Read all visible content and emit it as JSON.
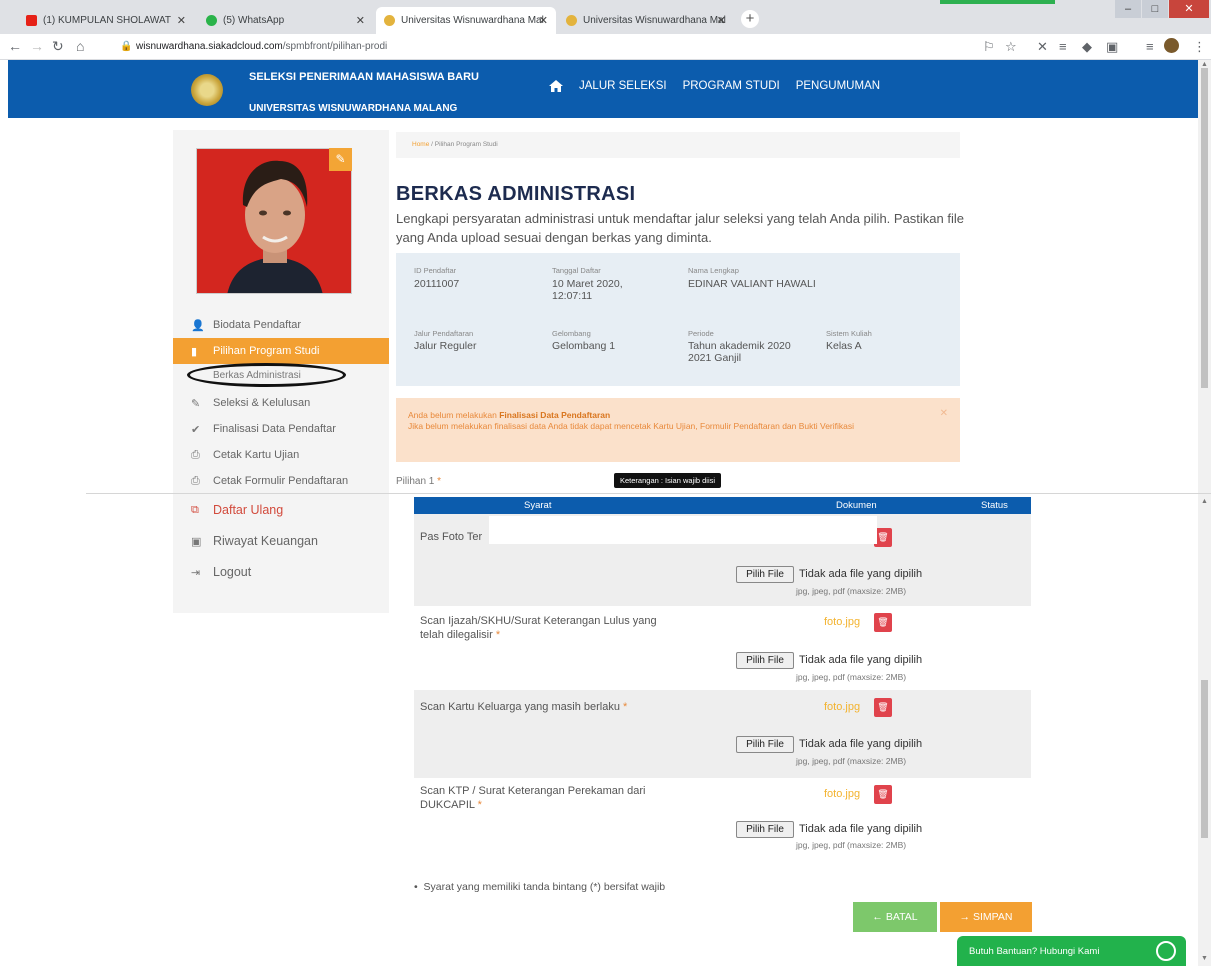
{
  "browser": {
    "tabs": [
      {
        "title": "(1) KUMPULAN SHOLAWAT",
        "color": "#e62117"
      },
      {
        "title": "(5) WhatsApp",
        "color": "#2ab34a"
      },
      {
        "title": "Universitas Wisnuwardhana Mal",
        "color": "#e3b33d"
      },
      {
        "title": "Universitas Wisnuwardhana Mal",
        "color": "#e3b33d"
      }
    ],
    "url_host": "wisnuwardhana.siakadcloud.com",
    "url_path": "/spmbfront/pilihan-prodi"
  },
  "header": {
    "brand_title": "SELEKSI PENERIMAAN MAHASISWA BARU",
    "brand_subtitle": "UNIVERSITAS WISNUWARDHANA MALANG",
    "nav": [
      "JALUR SELEKSI",
      "PROGRAM STUDI",
      "PENGUMUMAN"
    ]
  },
  "sidebar": {
    "menu": [
      {
        "label": "Biodata Pendaftar",
        "icon": "user-icon"
      },
      {
        "label": "Pilihan Program Studi",
        "icon": "bookmark-icon"
      },
      {
        "label": "Berkas Administrasi",
        "icon": "dash-icon"
      },
      {
        "label": "Seleksi & Kelulusan",
        "icon": "edit-icon"
      },
      {
        "label": "Finalisasi Data Pendaftar",
        "icon": "check-icon"
      },
      {
        "label": "Cetak Kartu Ujian",
        "icon": "print-icon"
      },
      {
        "label": "Cetak Formulir Pendaftaran",
        "icon": "print-icon"
      },
      {
        "label": "Daftar Ulang",
        "icon": "copy-icon"
      },
      {
        "label": "Riwayat Keuangan",
        "icon": "money-icon"
      },
      {
        "label": "Logout",
        "icon": "logout-icon"
      }
    ]
  },
  "breadcrumb": {
    "home": "Home",
    "current": "/ Pilihan Program Studi"
  },
  "page": {
    "title": "BERKAS ADMINISTRASI",
    "description": "Lengkapi persyaratan administrasi untuk mendaftar jalur seleksi yang telah Anda pilih. Pastikan file yang Anda upload sesuai dengan berkas yang diminta."
  },
  "info": {
    "id_label": "ID Pendaftar",
    "id_value": "20111007",
    "tanggal_label": "Tanggal Daftar",
    "tanggal_value": "10 Maret 2020, 12:07:11",
    "nama_label": "Nama Lengkap",
    "nama_value": "EDINAR VALIANT HAWALI",
    "jalur_label": "Jalur Pendaftaran",
    "jalur_value": "Jalur Reguler",
    "gelombang_label": "Gelombang",
    "gelombang_value": "Gelombang 1",
    "periode_label": "Periode",
    "periode_value": "Tahun akademik 2020 2021 Ganjil",
    "sistem_label": "Sistem Kuliah",
    "sistem_value": "Kelas A"
  },
  "alert": {
    "prefix": "Anda belum melakukan ",
    "bold": "Finalisasi Data Pendaftaran",
    "body": "Jika belum melakukan finalisasi data Anda tidak dapat mencetak Kartu Ujian, Formulir Pendaftaran dan Bukti Verifikasi"
  },
  "pilihan_label": "Pilihan 1",
  "tooltip": "Keterangan : Isian wajib diisi",
  "table": {
    "headers": [
      "Syarat",
      "Dokumen",
      "Status"
    ],
    "rows": [
      {
        "syarat": "Pas Foto Ter",
        "file": "",
        "button": "Pilih File",
        "nofile": "Tidak ada file yang dipilih",
        "hint": "jpg, jpeg, pdf (maxsize: 2MB)"
      },
      {
        "syarat": "Scan Ijazah/SKHU/Surat Keterangan Lulus yang telah dilegalisir",
        "file": "foto.jpg",
        "button": "Pilih File",
        "nofile": "Tidak ada file yang dipilih",
        "hint": "jpg, jpeg, pdf (maxsize: 2MB)"
      },
      {
        "syarat": "Scan Kartu Keluarga yang masih berlaku",
        "file": "foto.jpg",
        "button": "Pilih File",
        "nofile": "Tidak ada file yang dipilih",
        "hint": "jpg, jpeg, pdf (maxsize: 2MB)"
      },
      {
        "syarat": "Scan KTP / Surat Keterangan Perekaman dari DUKCAPIL",
        "file": "foto.jpg",
        "button": "Pilih File",
        "nofile": "Tidak ada file yang dipilih",
        "hint": "jpg, jpeg, pdf (maxsize: 2MB)"
      }
    ]
  },
  "note": "Syarat yang memiliki tanda bintang (*) bersifat wajib",
  "buttons": {
    "batal": "BATAL",
    "simpan": "SIMPAN"
  },
  "help": "Butuh Bantuan? Hubungi Kami",
  "colors": {
    "primary": "#0c5cad",
    "accent": "#f3a032",
    "danger": "#e0434c",
    "success": "#7dc86b"
  }
}
